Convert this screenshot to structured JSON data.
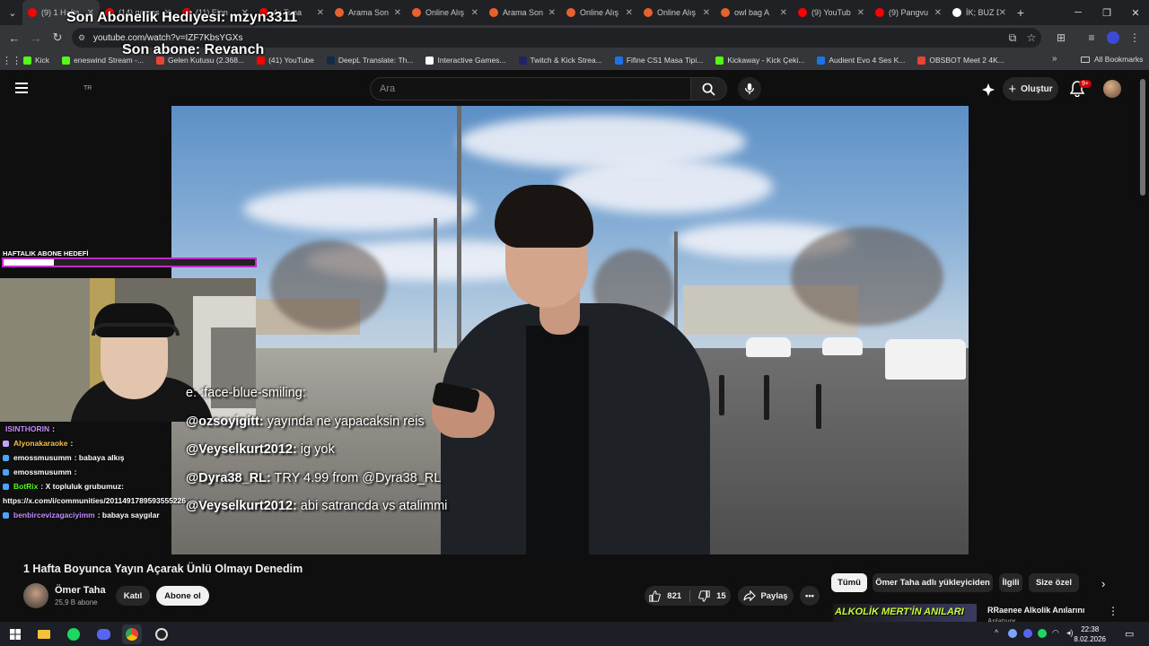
{
  "browser": {
    "tabs": [
      {
        "label": "(9) 1 Hafta",
        "color": "#ff0000"
      },
      {
        "label": "(14) games",
        "color": "#ff0000"
      },
      {
        "label": "(11) Elon",
        "color": "#ff0000"
      },
      {
        "label": "4x Tuna",
        "color": "#ff0000"
      },
      {
        "label": "Arama Son",
        "color": "#e8612c"
      },
      {
        "label": "Online Alış",
        "color": "#e8612c"
      },
      {
        "label": "Arama Son",
        "color": "#e8612c"
      },
      {
        "label": "Online Alış",
        "color": "#e8612c"
      },
      {
        "label": "Online Alış",
        "color": "#e8612c"
      },
      {
        "label": "owl bag A",
        "color": "#e8612c"
      },
      {
        "label": "(9) YouTub",
        "color": "#ff0000"
      },
      {
        "label": "(9) Pangvu",
        "color": "#ff0000"
      },
      {
        "label": "İK; BUZ D",
        "color": "#ffffff"
      }
    ],
    "url": "youtube.com/watch?v=IZF7KbsYGXs",
    "bookmarks": [
      {
        "label": "Kick",
        "color": "#53fc18"
      },
      {
        "label": "eneswind Stream -...",
        "color": "#53fc18"
      },
      {
        "label": "Gelen Kutusu (2.368...",
        "color": "#ea4335"
      },
      {
        "label": "(41) YouTube",
        "color": "#ff0000"
      },
      {
        "label": "DeepL Translate: Th...",
        "color": "#0f2b46"
      },
      {
        "label": "Interactive Games...",
        "color": "#ffffff"
      },
      {
        "label": "Twitch & Kick Strea...",
        "color": "#222266"
      },
      {
        "label": "Fifine CS1 Masa Tipi...",
        "color": "#1a73e8"
      },
      {
        "label": "Kickaway - Kick Çeki...",
        "color": "#53fc18"
      },
      {
        "label": "Audient Evo 4 Ses K...",
        "color": "#1a73e8"
      },
      {
        "label": "OBSBOT Meet 2 4K...",
        "color": "#ea4335"
      }
    ],
    "all_bookmarks": "All Bookmarks"
  },
  "youtube": {
    "logo_region": "TR",
    "search_placeholder": "Ara",
    "create_label": "Oluştur",
    "notif_count": "9+",
    "video": {
      "title": "1 Hafta Boyunca Yayın Açarak Ünlü Olmayı Denedim",
      "channel": "Ömer Taha",
      "subscribers": "25,9 B abone",
      "join_label": "Katıl",
      "subscribe_label": "Abone ol",
      "likes": "821",
      "dislikes": "15",
      "share_label": "Paylaş"
    },
    "chips": [
      "Tümü",
      "Ömer Taha adlı yükleyiciden",
      "İlgili",
      "Size özel"
    ],
    "recommended": {
      "banner_text": "ALKOLİK MERT'İN ANILARI",
      "title": "RRaenee Alkolik Anılarını",
      "subtitle": "Anlatıyor"
    }
  },
  "stream_overlay": {
    "last_sub_gift": "Son Abonelik Hediyesi: mzyn3311",
    "last_sub": "Son abone: Revanch",
    "goal_label": "HAFTALIK ABONE HEDEFİ",
    "goal_progress": 0.2,
    "chat": [
      {
        "user": "ISINTHORIN",
        "msg": ":",
        "color": "#c88cff",
        "badge": ""
      },
      {
        "user": "Alyonakaraoke",
        "msg": ":",
        "color": "#f4c542",
        "badge": "#c8a0ff"
      },
      {
        "user": "emossmusumm",
        "msg": ": babaya alkış",
        "color": "#ffffff",
        "badge": "#4aa3ff"
      },
      {
        "user": "emossmusumm",
        "msg": ":",
        "color": "#ffffff",
        "badge": "#4aa3ff"
      },
      {
        "user": "BotRix",
        "msg": ": X topluluk grubumuz:",
        "color": "#53fc18",
        "badge": "#4aa3ff"
      },
      {
        "user": "",
        "msg": "https://x.com/i/communities/2011491789593555226",
        "color": "#ffffff",
        "badge": ""
      },
      {
        "user": "benbircevizagaciyimm",
        "msg": ": babaya saygılar",
        "color": "#c88cff",
        "badge": "#4aa3ff"
      }
    ],
    "video_chat": [
      {
        "user": "",
        "msg": "e: :face-blue-smiling:"
      },
      {
        "user": "@ozsoyigitt:",
        "msg": " yayında ne yapacaksin reis"
      },
      {
        "user": "@Veyselkurt2012:",
        "msg": " ig yok"
      },
      {
        "user": "@Dyra38_RL:",
        "msg": " TRY 4.99 from @Dyra38_RL"
      },
      {
        "user": "@Veyselkurt2012:",
        "msg": " abi satrancda vs atalimmi"
      }
    ]
  },
  "taskbar": {
    "time": "22:38",
    "date": "8.02.2026"
  }
}
